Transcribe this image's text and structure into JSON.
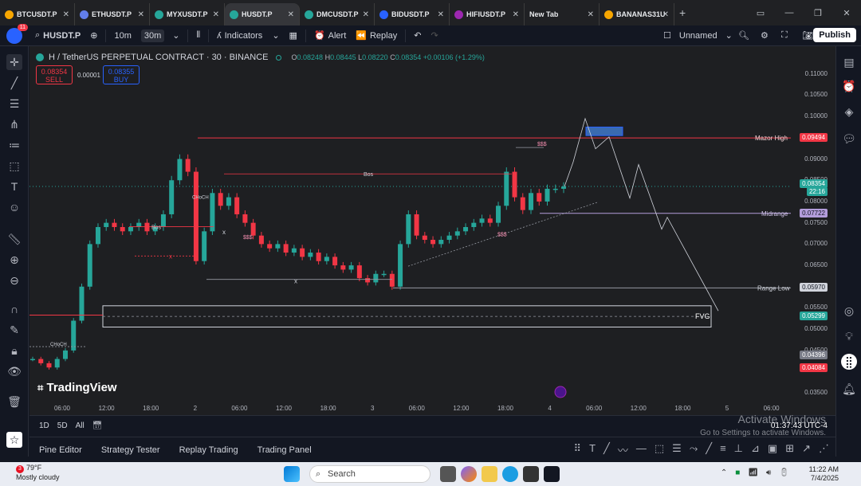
{
  "browser": {
    "tabs": [
      {
        "label": "BTCUSDT.P",
        "color": "#f7a600"
      },
      {
        "label": "ETHUSDT.P",
        "color": "#627eea"
      },
      {
        "label": "MYXUSDT.P",
        "color": "#26a69a"
      },
      {
        "label": "HUSDT.P",
        "color": "#26a69a"
      },
      {
        "label": "DMCUSDT.P",
        "color": "#26a69a"
      },
      {
        "label": "BIDUSDT.P",
        "color": "#2962ff"
      },
      {
        "label": "HIFIUSDT.P",
        "color": "#9c27b0"
      },
      {
        "label": "New Tab",
        "color": ""
      },
      {
        "label": "BANANAS31U",
        "color": "#f7a600"
      }
    ],
    "active_tab": 3
  },
  "toolbar": {
    "notification_count": "11",
    "symbol": "HUSDT.P",
    "timeframe_10m": "10m",
    "timeframe_30m": "30m",
    "indicators_label": "Indicators",
    "alert_label": "Alert",
    "replay_label": "Replay",
    "layout_name": "Unnamed",
    "publish_label": "Publish"
  },
  "legend": {
    "title": "H / TetherUS PERPETUAL CONTRACT · 30 · BINANCE",
    "open_label": "O",
    "open": "0.08248",
    "high_label": "H",
    "high": "0.08445",
    "low_label": "L",
    "low": "0.08220",
    "close_label": "C",
    "close": "0.08354",
    "change": "+0.00106 (+1.29%)",
    "sell_price": "0.08354",
    "sell_label": "SELL",
    "spread": "0.00001",
    "buy_price": "0.08355",
    "buy_label": "BUY"
  },
  "annotations": {
    "major_high": "Mazor High",
    "midrange": "Midrange",
    "range_low": "Range Low",
    "fvg": "FVG",
    "bos1": "Bos",
    "bos2": "Bos",
    "choch1": "CHoCH",
    "choch2": "CHoCH",
    "sss1": "$$$",
    "sss2": "$$$",
    "sss3": "$$$",
    "x1": "x",
    "x2": "x",
    "x3": "x"
  },
  "price_axis": {
    "levels": [
      "0.11000",
      "0.10500",
      "0.10000",
      "0.09000",
      "0.08500",
      "0.08000",
      "0.07500",
      "0.07000",
      "0.06500",
      "0.05500",
      "0.05000",
      "0.04500",
      "0.03500"
    ],
    "tag_major_high": "0.09494",
    "tag_current": "0.08354",
    "tag_countdown": "22:16",
    "tag_midrange": "0.07722",
    "tag_range_low": "0.05970",
    "tag_fvg": "0.05299",
    "tag_low1": "0.04396",
    "tag_low2": "0.04084",
    "colors": {
      "bull": "#26a69a",
      "bear": "#f23645",
      "midrange": "#b39ddb"
    }
  },
  "time_axis": [
    "06:00",
    "12:00",
    "18:00",
    "2",
    "06:00",
    "12:00",
    "18:00",
    "3",
    "06:00",
    "12:00",
    "18:00",
    "4",
    "06:00",
    "12:00",
    "18:00",
    "5",
    "06:00"
  ],
  "range_bar": {
    "r1": "1D",
    "r2": "5D",
    "r3": "All",
    "clock": "01:37:43 UTC-4"
  },
  "watermark": {
    "line1": "Activate Windows",
    "line2": "Go to Settings to activate Windows."
  },
  "tv_logo": "TradingView",
  "bottom_tabs": [
    "Pine Editor",
    "Strategy Tester",
    "Replay Trading",
    "Trading Panel"
  ],
  "taskbar": {
    "weather_temp": "79°F",
    "weather_desc": "Mostly cloudy",
    "weather_badge": "3",
    "search_placeholder": "Search",
    "time": "11:22 AM",
    "date": "7/4/2025"
  },
  "chart_data": {
    "type": "candlestick",
    "x_ticks": [
      "06:00",
      "12:00",
      "18:00",
      "2",
      "06:00",
      "12:00",
      "18:00",
      "3",
      "06:00",
      "12:00",
      "18:00",
      "4",
      "06:00",
      "12:00",
      "18:00",
      "5",
      "06:00"
    ],
    "ylim": [
      0.034,
      0.112
    ],
    "y_ticks": [
      0.035,
      0.045,
      0.05,
      0.055,
      0.065,
      0.07,
      0.075,
      0.08,
      0.085,
      0.09,
      0.1,
      0.105,
      0.11
    ],
    "close_series": [
      0.043,
      0.042,
      0.041,
      0.043,
      0.045,
      0.052,
      0.06,
      0.07,
      0.074,
      0.075,
      0.074,
      0.073,
      0.074,
      0.075,
      0.073,
      0.074,
      0.077,
      0.085,
      0.09,
      0.087,
      0.066,
      0.073,
      0.082,
      0.079,
      0.081,
      0.077,
      0.075,
      0.072,
      0.07,
      0.069,
      0.07,
      0.068,
      0.069,
      0.067,
      0.068,
      0.066,
      0.067,
      0.065,
      0.064,
      0.065,
      0.062,
      0.061,
      0.063,
      0.063,
      0.06,
      0.07,
      0.077,
      0.072,
      0.071,
      0.07,
      0.071,
      0.072,
      0.073,
      0.074,
      0.075,
      0.076,
      0.075,
      0.079,
      0.087,
      0.081,
      0.078,
      0.082,
      0.08,
      0.083,
      0.083,
      0.0835
    ],
    "projection_path": [
      [
        0.0835,
        0.098
      ],
      [
        0.091,
        0.0975
      ],
      [
        0.0935,
        0.08
      ],
      [
        0.084,
        0.073
      ],
      [
        0.064,
        0.0545
      ]
    ],
    "levels": {
      "major_high": 0.09494,
      "midrange": 0.07722,
      "range_low": 0.0597,
      "fvg_top": 0.0555,
      "fvg_bottom": 0.0505,
      "current": 0.08354
    }
  }
}
